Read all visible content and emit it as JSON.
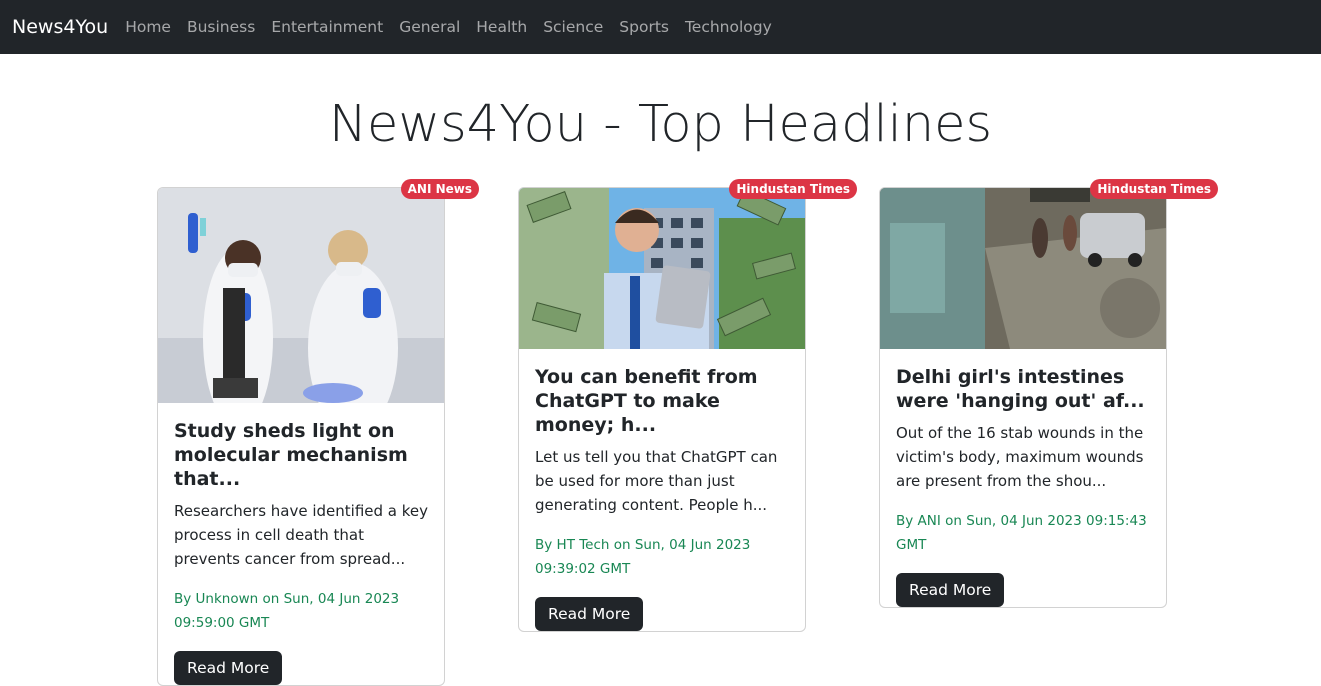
{
  "nav": {
    "brand": "News4You",
    "links": [
      "Home",
      "Business",
      "Entertainment",
      "General",
      "Health",
      "Science",
      "Sports",
      "Technology"
    ]
  },
  "page": {
    "title": "News4You - Top Headlines"
  },
  "cards": [
    {
      "source": "ANI News",
      "title": "Study sheds light on molecular mechanism that...",
      "description": "Researchers have identified a key process in cell death that prevents cancer from spread...",
      "meta": "By Unknown on Sun, 04 Jun 2023 09:59:00 GMT",
      "button": "Read More"
    },
    {
      "source": "Hindustan Times",
      "title": "You can benefit from ChatGPT to make money; h...",
      "description": "Let us tell you that ChatGPT can be used for more than just generating content. People h...",
      "meta": "By HT Tech on Sun, 04 Jun 2023 09:39:02 GMT",
      "button": "Read More"
    },
    {
      "source": "Hindustan Times",
      "title": "Delhi girl's intestines were 'hanging out' af...",
      "description": "Out of the 16 stab wounds in the victim's body, maximum wounds are present from the shou...",
      "meta": "By ANI on Sun, 04 Jun 2023 09:15:43 GMT",
      "button": "Read More"
    }
  ]
}
